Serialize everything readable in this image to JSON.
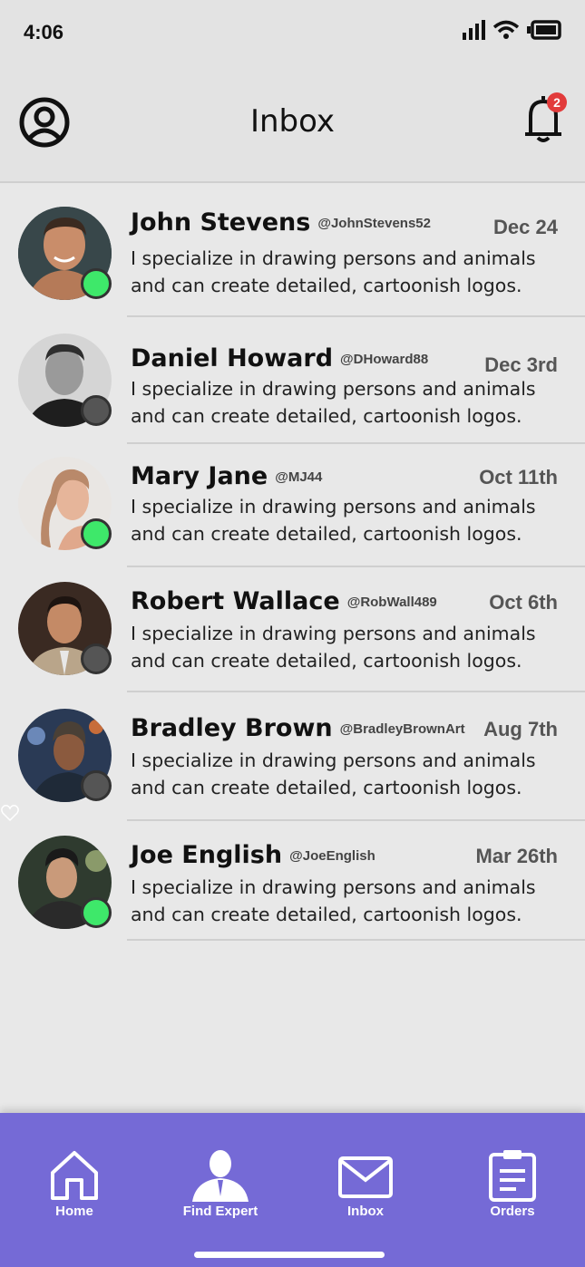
{
  "status": {
    "time": "4:06"
  },
  "header": {
    "title": "Inbox",
    "notification_count": "2"
  },
  "messages": [
    {
      "name": "John Stevens",
      "handle": "@JohnStevens52",
      "date": "Dec 24",
      "text": "I specialize in drawing persons and animals and can create detailed, cartoonish logos.",
      "online": true
    },
    {
      "name": "Daniel Howard",
      "handle": "@DHoward88",
      "date": "Dec 3rd",
      "text": "I specialize in drawing persons and animals and can create detailed, cartoonish logos.",
      "online": false
    },
    {
      "name": "Mary Jane",
      "handle": "@MJ44",
      "date": "Oct 11th",
      "text": "I specialize in drawing persons and animals and can create detailed, cartoonish logos.",
      "online": true
    },
    {
      "name": "Robert Wallace",
      "handle": "@RobWall489",
      "date": "Oct 6th",
      "text": "I specialize in drawing persons and animals and can create detailed, cartoonish logos.",
      "online": false
    },
    {
      "name": "Bradley Brown",
      "handle": "@BradleyBrownArt",
      "date": "Aug 7th",
      "text": "I specialize in drawing persons and animals and can create detailed, cartoonish logos.",
      "online": false
    },
    {
      "name": "Joe English",
      "handle": "@JoeEnglish",
      "date": "Mar 26th",
      "text": "I specialize in drawing persons and animals and can create detailed, cartoonish logos.",
      "online": true
    }
  ],
  "nav": {
    "home": "Home",
    "find_expert": "Find Expert",
    "inbox": "Inbox",
    "orders": "Orders"
  },
  "colors": {
    "nav_bg": "#756ad6",
    "online": "#3ee86a",
    "offline": "#555555",
    "badge": "#e23b3b"
  }
}
